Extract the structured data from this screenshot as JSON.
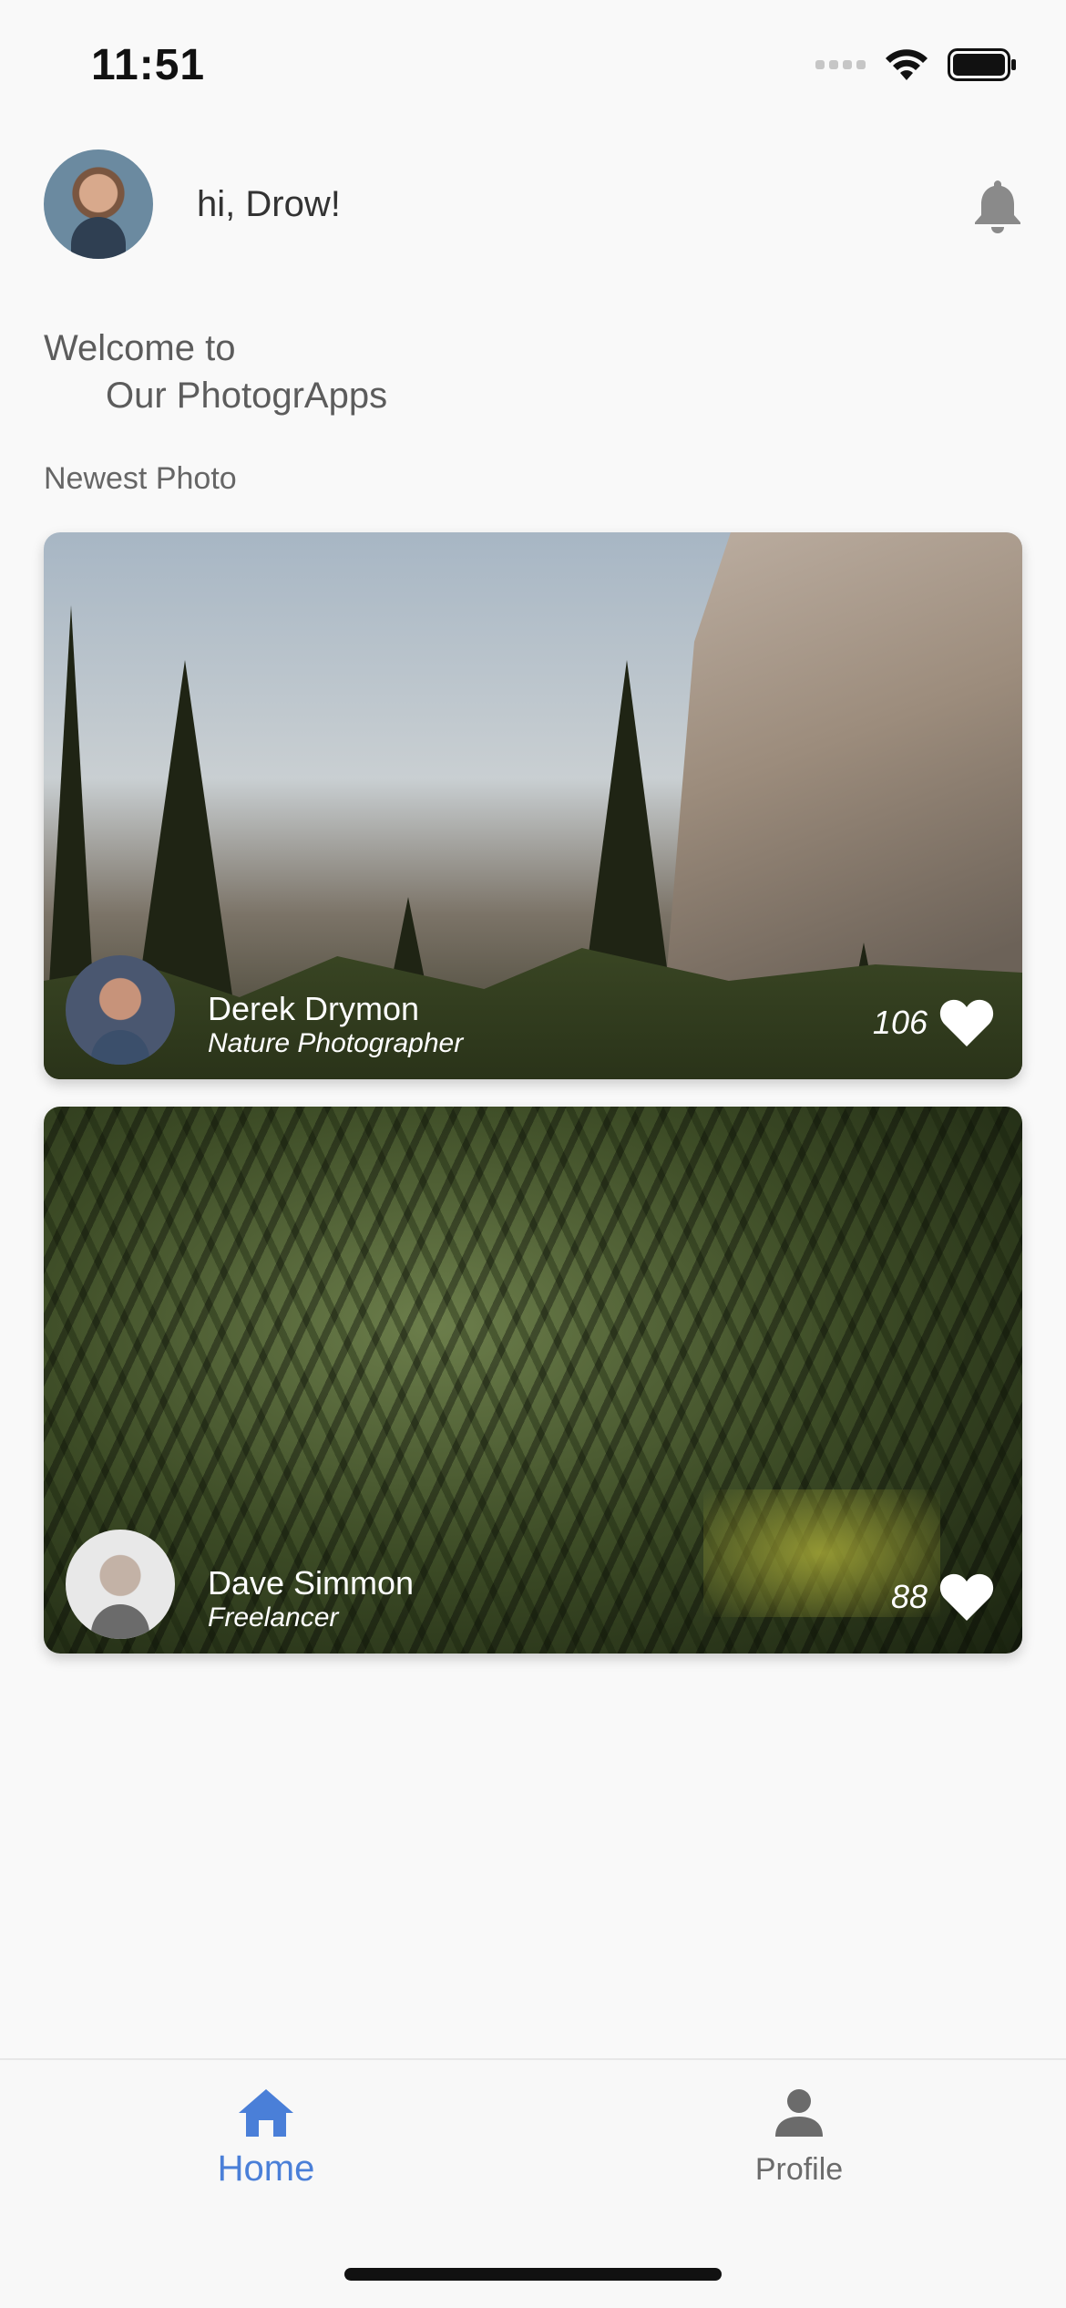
{
  "status_bar": {
    "time": "11:51",
    "icons": [
      "cellular-signal-icon",
      "wifi-icon",
      "battery-icon"
    ]
  },
  "header": {
    "greeting": "hi, Drow!",
    "avatar": "user-avatar",
    "notification_icon": "bell-icon"
  },
  "welcome": {
    "line1": "Welcome to",
    "line2": "Our PhotogrApps"
  },
  "section": {
    "title": "Newest Photo"
  },
  "photos": [
    {
      "photographer": "Derek Drymon",
      "role": "Nature Photographer",
      "likes": "106",
      "image": "mountain-forest-photo",
      "like_icon": "heart-icon"
    },
    {
      "photographer": "Dave Simmon",
      "role": "Freelancer",
      "likes": "88",
      "image": "palm-leaves-photo",
      "like_icon": "heart-icon"
    }
  ],
  "tabbar": {
    "tabs": [
      {
        "label": "Home",
        "icon": "home-icon",
        "active": true
      },
      {
        "label": "Profile",
        "icon": "person-icon",
        "active": false
      }
    ]
  },
  "colors": {
    "background": "#f9f9f9",
    "accent": "#4a7fd8",
    "inactive_tab": "#6b6b6b",
    "text_muted": "#5c5c5c"
  }
}
